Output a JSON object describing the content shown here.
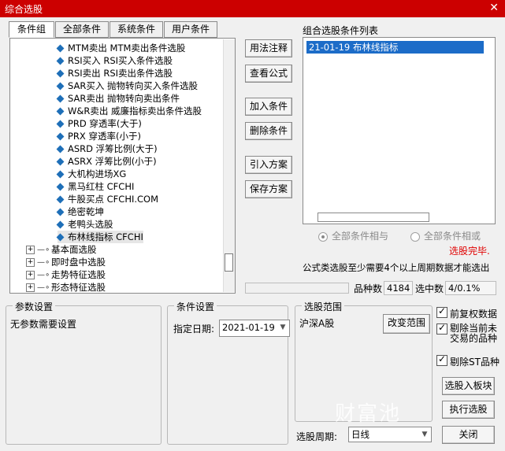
{
  "window": {
    "title": "综合选股",
    "close_glyph": "✕"
  },
  "tabs": [
    "条件组",
    "全部条件",
    "系统条件",
    "用户条件"
  ],
  "tree": {
    "formulas": [
      {
        "label": "MTM卖出 MTM卖出条件选股"
      },
      {
        "label": "RSI买入 RSI买入条件选股"
      },
      {
        "label": "RSI卖出 RSI卖出条件选股"
      },
      {
        "label": "SAR买入 抛物转向买入条件选股"
      },
      {
        "label": "SAR卖出 抛物转向卖出条件"
      },
      {
        "label": "W&R卖出 威廉指标卖出条件选股"
      },
      {
        "label": "PRD 穿透率(大于)"
      },
      {
        "label": "PRX 穿透率(小于)"
      },
      {
        "label": "ASRD 浮筹比例(大于)"
      },
      {
        "label": "ASRX 浮筹比例(小于)"
      },
      {
        "label": "大机构进场XG"
      },
      {
        "label": "黑马红柱 CFCHI"
      },
      {
        "label": "牛股买点 CFCHI.COM"
      },
      {
        "label": "绝密乾坤"
      },
      {
        "label": "老鸭头选股"
      },
      {
        "label": "布林线指标 CFCHI"
      }
    ],
    "groups": [
      {
        "label": "基本面选股"
      },
      {
        "label": "即时盘中选股"
      },
      {
        "label": "走势特征选股"
      },
      {
        "label": "形态特征选股"
      }
    ]
  },
  "buttons": {
    "usage": "用法注释",
    "view_formula": "查看公式",
    "add_condition": "加入条件",
    "delete_condition": "删除条件",
    "import_plan": "引入方案",
    "save_plan": "保存方案",
    "change_range": "改变范围",
    "select_to_block": "选股入板块",
    "execute": "执行选股",
    "close": "关闭"
  },
  "condition_list": {
    "title": "组合选股条件列表",
    "items": [
      "21-01-19 布林线指标"
    ]
  },
  "logic": {
    "and_label": "全部条件相与",
    "or_label": "全部条件相或"
  },
  "status_done": "选股完毕.",
  "note": "公式类选股至少需要4个以上周期数据才能选出",
  "stats": {
    "count_label": "品种数",
    "count_value": "4184",
    "selected_label": "选中数",
    "selected_value": "4/0.1%"
  },
  "params": {
    "title": "参数设置",
    "text": "无参数需要设置"
  },
  "cond_settings": {
    "title": "条件设置",
    "date_label": "指定日期:",
    "date_value": "2021-01-19"
  },
  "range": {
    "title": "选股范围",
    "value": "沪深A股"
  },
  "options": {
    "pre_adjust": "前复权数据",
    "exclude_untraded": "剔除当前未交易的品种",
    "exclude_st": "剔除ST品种"
  },
  "period": {
    "label": "选股周期:",
    "value": "日线"
  },
  "watermark": "财富池",
  "colors": {
    "title_bar": "#cc0000",
    "selection": "#1c6cc8",
    "status_red": "#e00000",
    "icon_blue": "#1e6fb8"
  }
}
